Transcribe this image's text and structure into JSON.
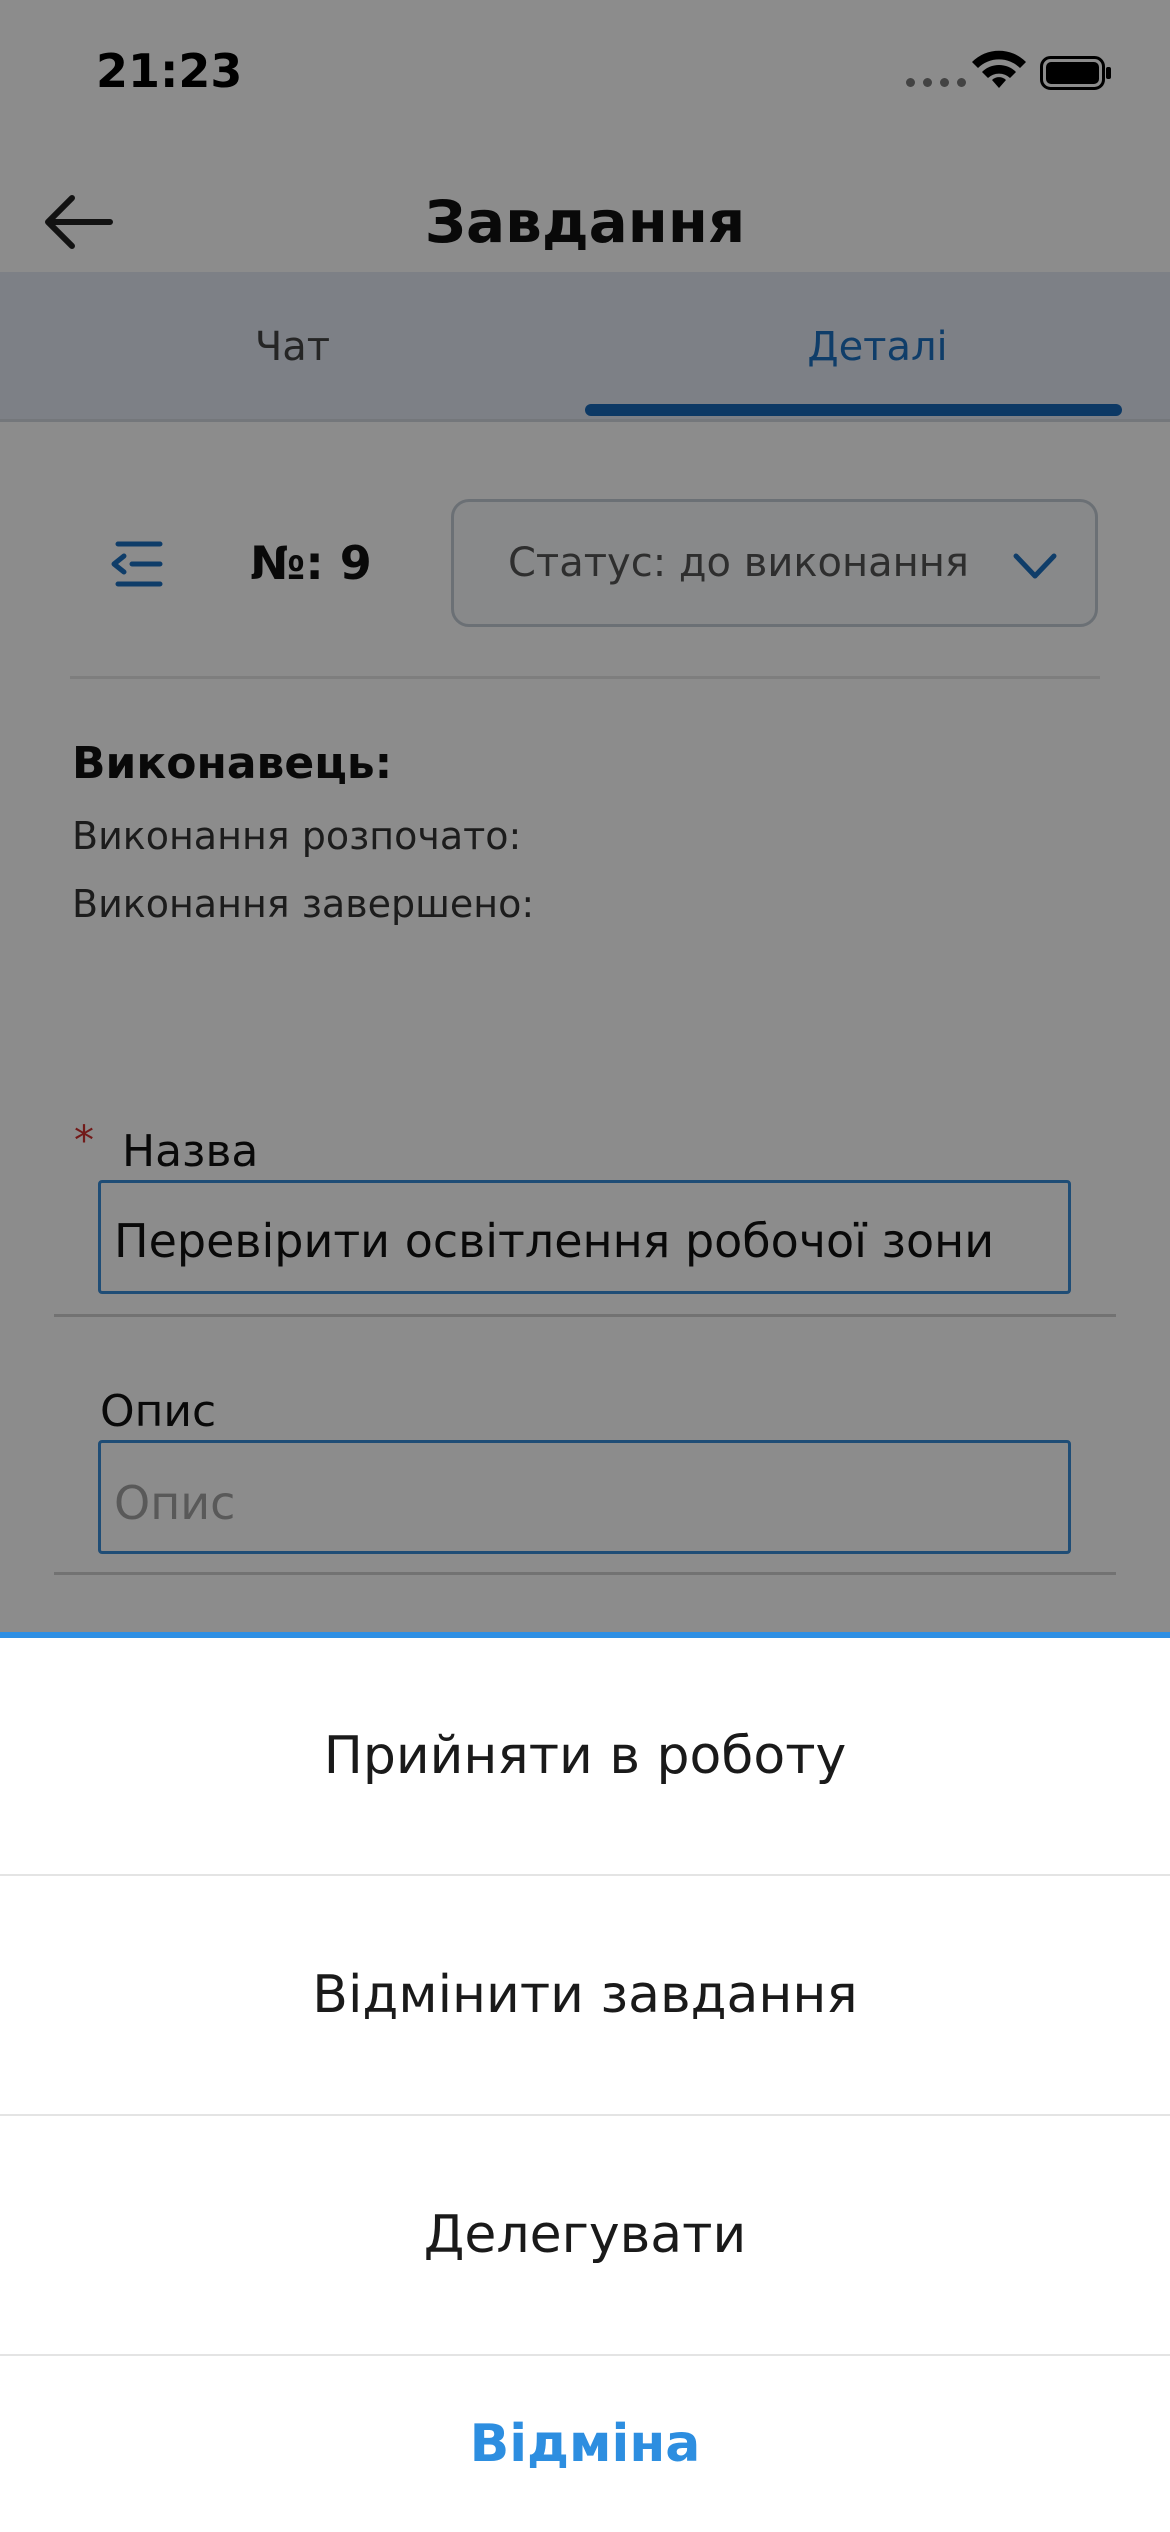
{
  "status_bar": {
    "time": "21:23"
  },
  "header": {
    "title": "Завдання"
  },
  "tabs": [
    {
      "label": "Чат",
      "active": false
    },
    {
      "label": "Деталі",
      "active": true
    }
  ],
  "task": {
    "number_label": "№: 9",
    "status_label": "Статус: до виконання",
    "executor_label": "Виконавець:",
    "started_label": "Виконання розпочато:",
    "finished_label": "Виконання завершено:"
  },
  "form": {
    "required_mark": "*",
    "name_label": "Назва",
    "name_value": "Перевірити освітлення робочої зони",
    "description_label": "Опис",
    "description_placeholder": "Опис"
  },
  "action_sheet": {
    "accept": "Прийняти в роботу",
    "cancel_task": "Відмінити завдання",
    "delegate": "Делегувати",
    "dismiss": "Відміна"
  },
  "colors": {
    "accent": "#1868b8",
    "sheet_accent": "#2f8fe3",
    "required": "#d0302f",
    "tab_bar": "#e3eaf4"
  }
}
